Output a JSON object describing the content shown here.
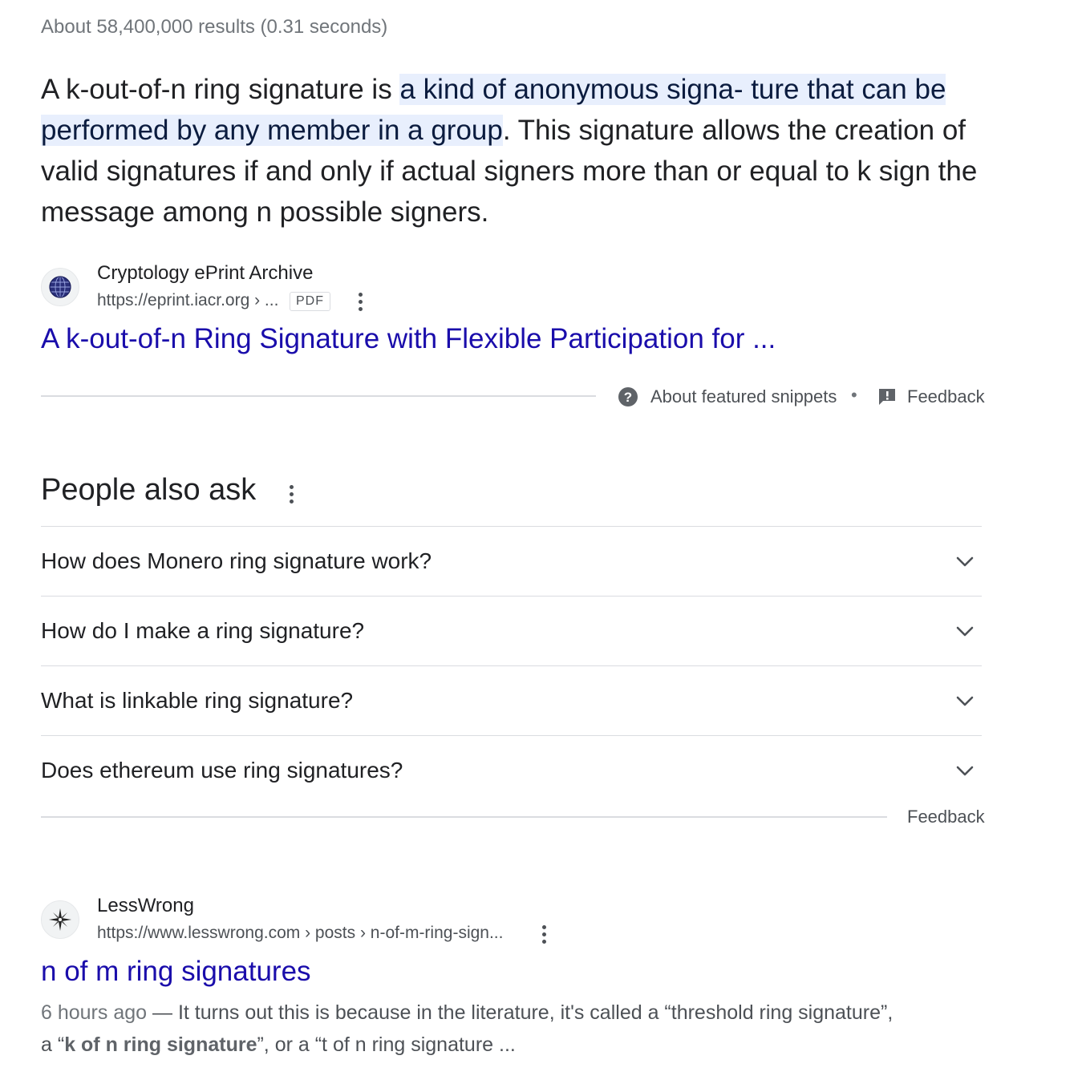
{
  "result_stats": "About 58,400,000 results (0.31 seconds)",
  "featured_snippet": {
    "text_before": "A k-out-of-n ring signature is ",
    "highlighted": "a kind of anonymous signa- ture that can be performed by any member in a group",
    "text_after": ". This signature allows the creation of valid signatures if and only if actual signers more than or equal to k sign the message among n possible signers.",
    "source": {
      "site_name": "Cryptology ePrint Archive",
      "url": "https://eprint.iacr.org › ...",
      "badge": "PDF",
      "title": "A k-out-of-n Ring Signature with Flexible Participation for ..."
    },
    "footer": {
      "about_label": "About featured snippets",
      "separator": "•",
      "feedback_label": "Feedback"
    }
  },
  "people_also_ask": {
    "heading": "People also ask",
    "questions": [
      "How does Monero ring signature work?",
      "How do I make a ring signature?",
      "What is linkable ring signature?",
      "Does ethereum use ring signatures?"
    ],
    "feedback_label": "Feedback"
  },
  "result": {
    "site_name": "LessWrong",
    "url": "https://www.lesswrong.com › posts › n-of-m-ring-sign...",
    "title": "n of m ring signatures",
    "date": "6 hours ago",
    "dash": " — ",
    "snippet_line1": "It turns out this is because in the literature, it's called a “threshold ring signature”,",
    "snippet_a": "a “",
    "snippet_bold": "k of n ring signature",
    "snippet_b": "”, or a “t of n ring signature ..."
  },
  "colors": {
    "link": "#1a0dab",
    "highlight_bg": "#e8effd",
    "text": "#202124",
    "muted": "#4d5156"
  }
}
